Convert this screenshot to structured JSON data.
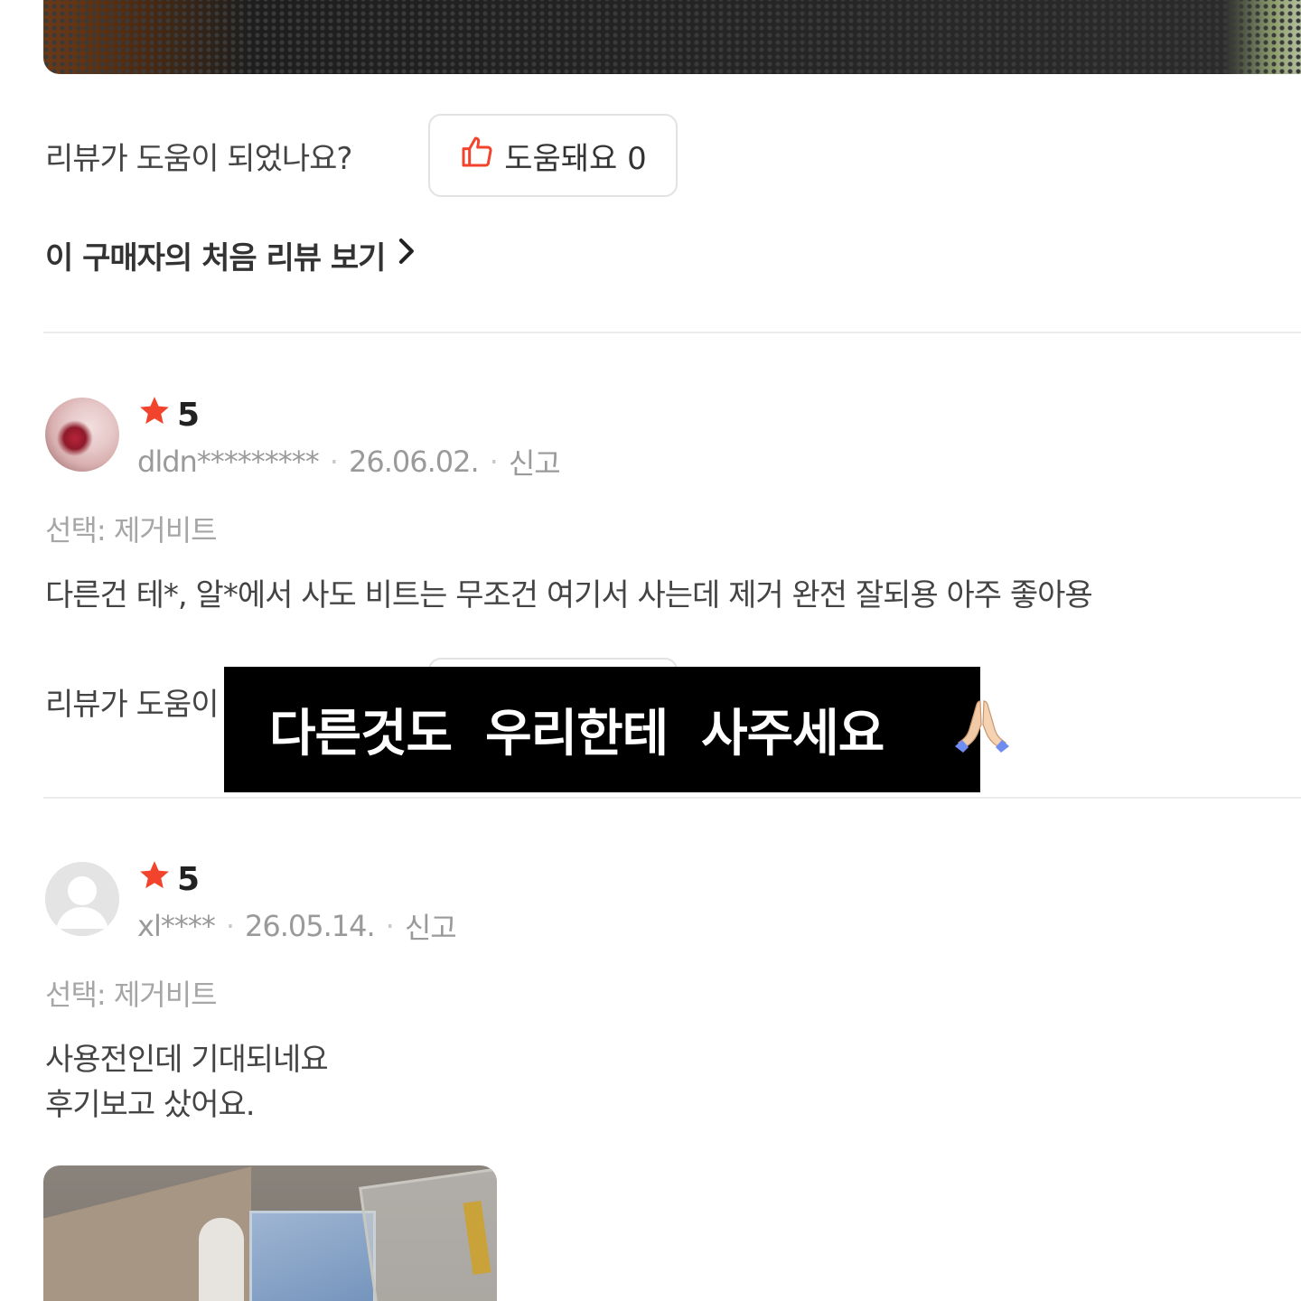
{
  "helpful_question": "리뷰가 도움이 되었나요?",
  "helpful_button_label": "도움돼요 0",
  "first_review_link": "이 구매자의 처음 리뷰 보기",
  "reviews": [
    {
      "rating": "5",
      "author": "dldn*********",
      "date": "26.06.02.",
      "report": "신고",
      "option": "선택: 제거비트",
      "text_lines": [
        "다른건 테*, 알*에서 사도 비트는 무조건 여기서 사는데 제거 완전 잘되용 아주 좋아용"
      ],
      "helpful_question_partial": "리뷰가 도움이"
    },
    {
      "rating": "5",
      "author": "xl****",
      "date": "26.05.14.",
      "report": "신고",
      "option": "선택: 제거비트",
      "text_lines": [
        "사용전인데 기대되네요",
        "후기보고 샀어요."
      ]
    }
  ],
  "caption_overlay": "다른것도  우리한테  사주세요",
  "icons": {
    "thumbs_up": "thumbs-up-icon",
    "chevron": "chevron-right-icon",
    "star": "star-icon",
    "avatar_default": "user-icon",
    "praying_hands": "praying-hands-emoji"
  },
  "colors": {
    "accent_red": "#f2442d",
    "star": "#f2442d",
    "text_main": "#333333",
    "text_muted": "#9a9a9a",
    "caption_bg": "#000000"
  }
}
